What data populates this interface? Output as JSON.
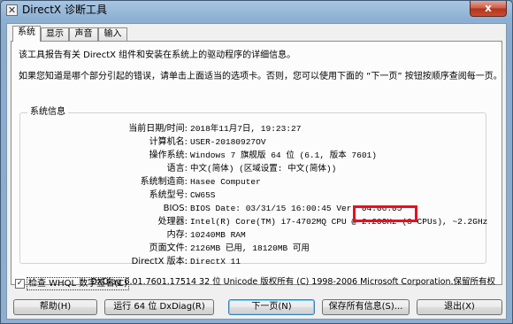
{
  "window": {
    "title": "DirectX 诊断工具",
    "close_glyph": "x",
    "icon_glyph": "✕"
  },
  "tabs": [
    {
      "label": "系统",
      "active": true
    },
    {
      "label": "显示",
      "active": false
    },
    {
      "label": "声音",
      "active": false
    },
    {
      "label": "输入",
      "active": false
    }
  ],
  "intro": {
    "line1": "该工具报告有关 DirectX 组件和安装在系统上的驱动程序的详细信息。",
    "line2": "如果您知道是哪个部分引起的错误，请单击上面适当的选项卡。否则，您可以使用下面的 “下一页” 按钮按顺序查阅每一页。"
  },
  "system_info": {
    "group_title": "系统信息",
    "rows": [
      {
        "label": "当前日期/时间:",
        "value": "2018年11月7日, 19:23:27"
      },
      {
        "label": "计算机名:",
        "value": "USER-20180927OV"
      },
      {
        "label": "操作系统:",
        "value": "Windows 7 旗舰版 64 位 (6.1, 版本 7601)"
      },
      {
        "label": "语言:",
        "value": "中文(简体) (区域设置: 中文(简体))"
      },
      {
        "label": "系统制造商:",
        "value": "Hasee Computer"
      },
      {
        "label": "系统型号:",
        "value": "CW65S"
      },
      {
        "label": "BIOS:",
        "value": "BIOS Date: 03/31/15 16:00:45 Ver: 04.06.05"
      },
      {
        "label": "处理器:",
        "value": "Intel(R) Core(TM) i7-4702MQ CPU @ 2.20GHz (8 CPUs), ~2.2GHz"
      },
      {
        "label": "内存:",
        "value": "10240MB RAM"
      },
      {
        "label": "页面文件:",
        "value": "2126MB 已用, 18120MB 可用"
      },
      {
        "label": "DirectX 版本:",
        "value": "DirectX 11"
      }
    ]
  },
  "whql": {
    "label": "检查 WHQL 数字签名(C)",
    "checked": true,
    "check_glyph": "✓"
  },
  "copyright": "DxDiag 6.01.7601.17514 32 位 Unicode 版权所有 (C) 1998-2006 Microsoft Corporation.保留所有权",
  "buttons": {
    "help": "帮助(H)",
    "run64": "运行 64 位 DxDiag(R)",
    "next": "下一页(N)",
    "save": "保存所有信息(S)...",
    "exit": "退出(X)"
  },
  "colors": {
    "highlight_box": "#e8101f",
    "title_bar": "#a9c6e2",
    "close_button": "#c75a45"
  }
}
